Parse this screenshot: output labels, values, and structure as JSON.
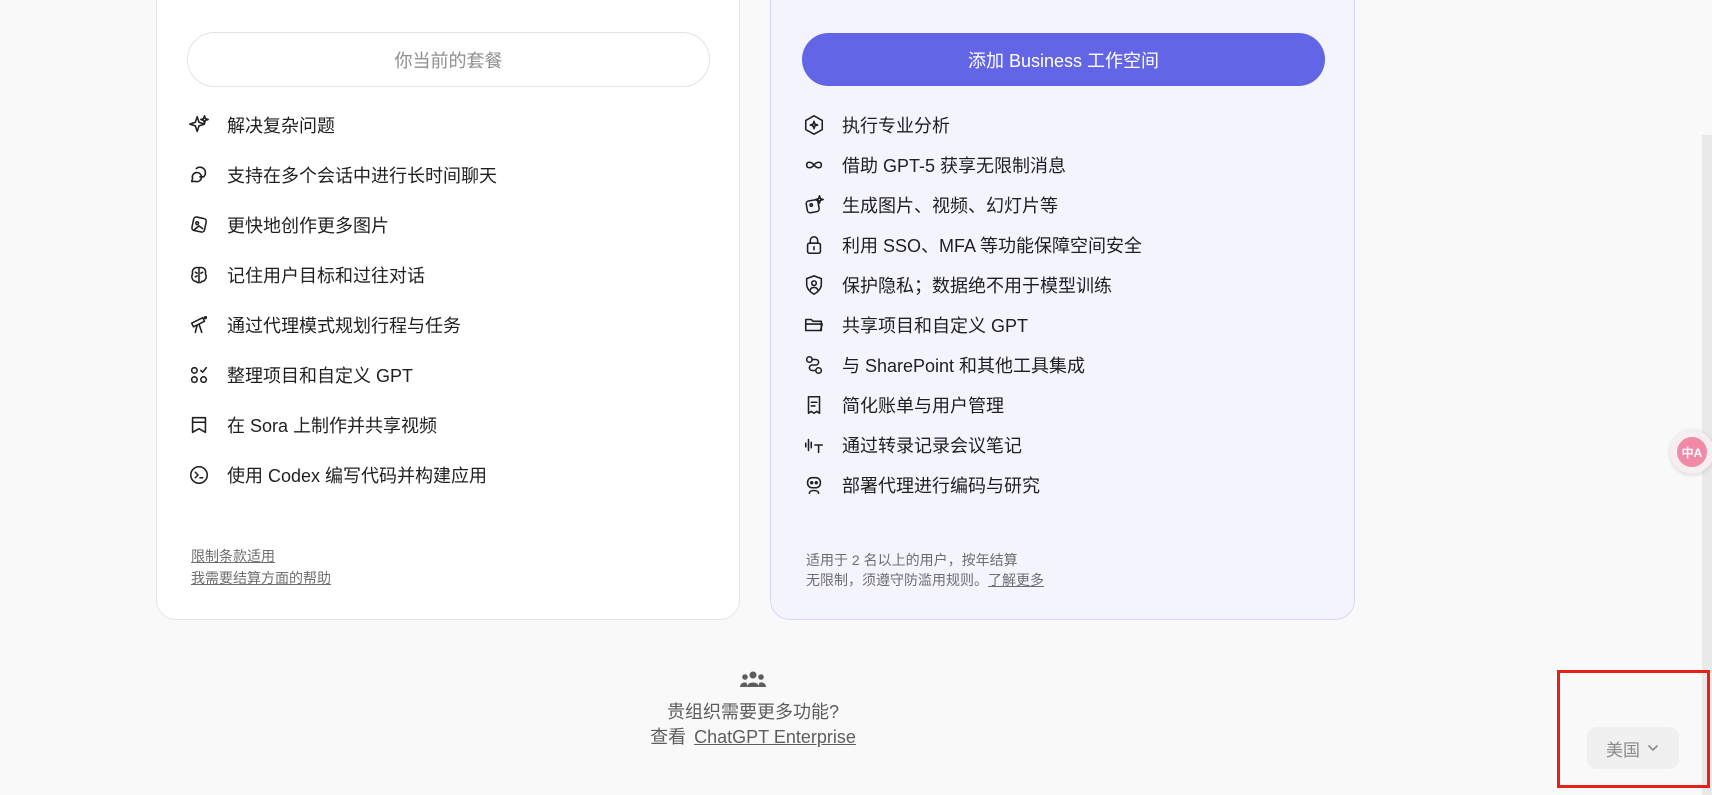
{
  "left_plan": {
    "button_label": "你当前的套餐",
    "features": [
      {
        "icon": "sparkle-icon",
        "label": "解决复杂问题"
      },
      {
        "icon": "chat-bubbles-icon",
        "label": "支持在多个会话中进行长时间聊天"
      },
      {
        "icon": "image-gallery-icon",
        "label": "更快地创作更多图片"
      },
      {
        "icon": "brain-icon",
        "label": "记住用户目标和过往对话"
      },
      {
        "icon": "telescope-icon",
        "label": "通过代理模式规划行程与任务"
      },
      {
        "icon": "apps-check-icon",
        "label": "整理项目和自定义 GPT"
      },
      {
        "icon": "book-icon",
        "label": "在 Sora 上制作并共享视频"
      },
      {
        "icon": "terminal-icon",
        "label": "使用 Codex 编写代码并构建应用"
      }
    ],
    "terms_link": "限制条款适用",
    "billing_help_link": "我需要结算方面的帮助"
  },
  "right_plan": {
    "button_label": "添加 Business 工作空间",
    "features": [
      {
        "icon": "hexagon-sparkle-icon",
        "label": "执行专业分析"
      },
      {
        "icon": "infinity-icon",
        "label": "借助 GPT-5 获享无限制消息"
      },
      {
        "icon": "image-sparkle-icon",
        "label": "生成图片、视频、幻灯片等"
      },
      {
        "icon": "lock-icon",
        "label": "利用 SSO、MFA 等功能保障空间安全"
      },
      {
        "icon": "shield-user-icon",
        "label": "保护隐私；数据绝不用于模型训练"
      },
      {
        "icon": "folder-icon",
        "label": "共享项目和自定义 GPT"
      },
      {
        "icon": "integration-icon",
        "label": "与 SharePoint 和其他工具集成"
      },
      {
        "icon": "receipt-icon",
        "label": "简化账单与用户管理"
      },
      {
        "icon": "transcribe-icon",
        "label": "通过转录记录会议笔记"
      },
      {
        "icon": "robot-icon",
        "label": "部署代理进行编码与研究"
      }
    ],
    "note_line1": "适用于 2 名以上的用户，按年结算",
    "note_line2": "无限制，须遵守防滥用规则。",
    "learn_more_link": "了解更多"
  },
  "enterprise": {
    "question": "贵组织需要更多功能?",
    "prefix": "查看",
    "link": "ChatGPT Enterprise"
  },
  "region_selector": {
    "value": "美国"
  },
  "translate_widget": {
    "label": "中A"
  },
  "colors": {
    "accent": "#6165e6",
    "highlight_box": "#e8201a"
  }
}
